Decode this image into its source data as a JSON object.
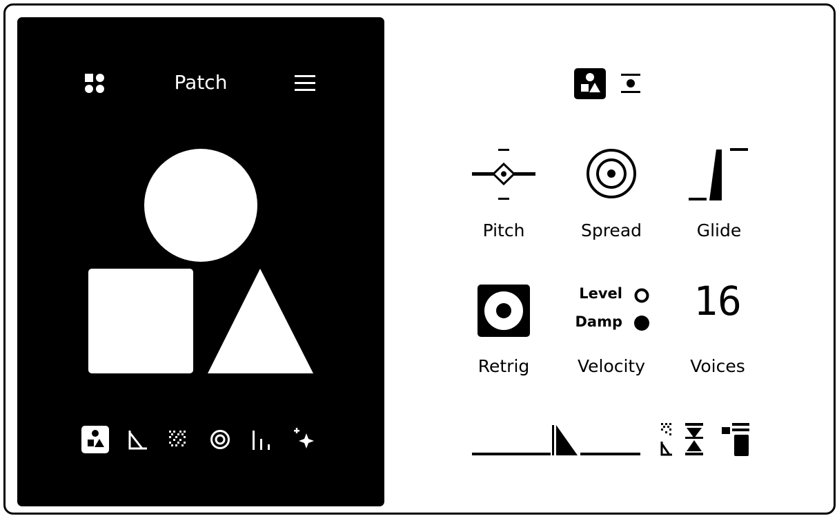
{
  "device": {
    "title": "Patch",
    "icons": {
      "left": "grid-icon",
      "right": "menu-icon"
    },
    "nav": [
      "shapes-icon",
      "envelope-icon",
      "noise-icon",
      "target-icon",
      "bars-icon",
      "sparkle-icon"
    ]
  },
  "panel": {
    "mode_icons": [
      "shapes-icon",
      "center-icon"
    ],
    "params": {
      "pitch": "Pitch",
      "spread": "Spread",
      "glide": "Glide",
      "retrig": "Retrig",
      "velocity": "Velocity",
      "voices": "Voices"
    },
    "velocity_options": {
      "level": "Level",
      "damp": "Damp"
    },
    "voices_value": "16",
    "bottom_icons": [
      "envelope-shape-icon",
      "noise-corner-icon",
      "hourglass-icon",
      "stack-icon"
    ]
  }
}
